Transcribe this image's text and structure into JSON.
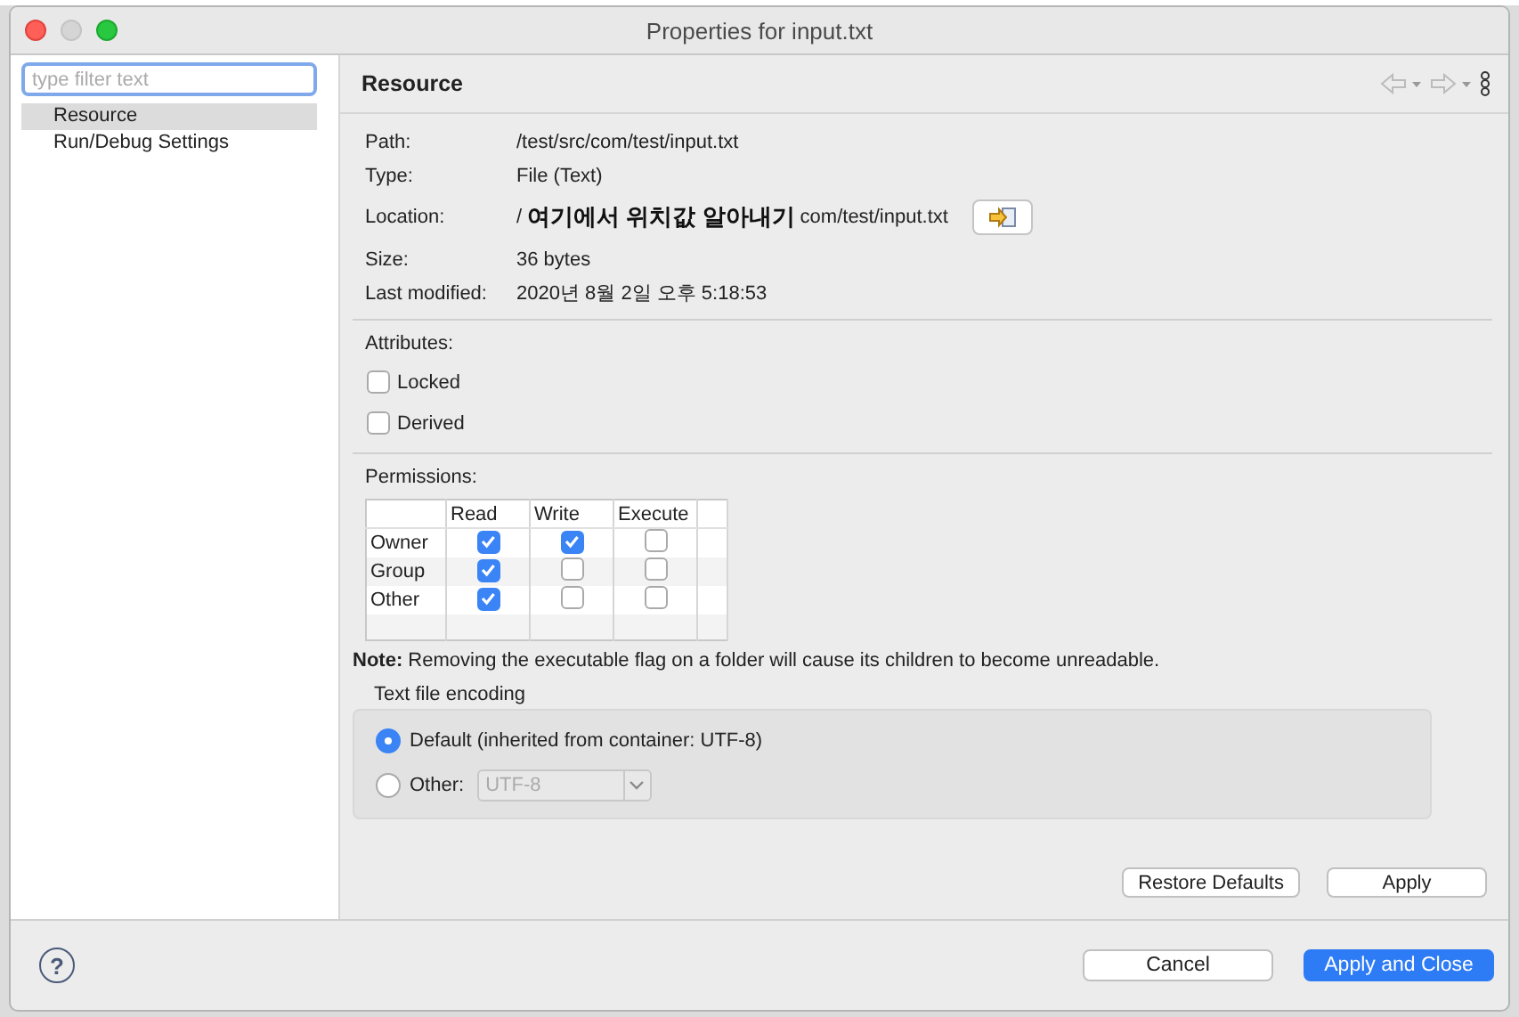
{
  "window": {
    "title": "Properties for input.txt"
  },
  "filter": {
    "placeholder": "type filter text"
  },
  "sidebar": {
    "items": [
      {
        "label": "Resource",
        "selected": true
      },
      {
        "label": "Run/Debug Settings",
        "selected": false
      }
    ]
  },
  "page": {
    "title": "Resource",
    "info": [
      {
        "label": "Path:",
        "value": "/test/src/com/test/input.txt"
      },
      {
        "label": "Type:",
        "value": "File  (Text)"
      },
      {
        "label": "Location:",
        "kind": "location",
        "value_start": "/",
        "annotation": "여기에서 위치값 알아내기",
        "value_end": "com/test/input.txt"
      },
      {
        "label": "Size:",
        "value": "36  bytes"
      },
      {
        "label": "Last modified:",
        "value": "2020년 8월 2일 오후 5:18:53"
      }
    ],
    "attributes_label": "Attributes:",
    "attributes": [
      {
        "label": "Locked",
        "checked": false
      },
      {
        "label": "Derived",
        "checked": false
      }
    ],
    "permissions_label": "Permissions:",
    "permissions": {
      "columns": [
        "Read",
        "Write",
        "Execute"
      ],
      "rows": [
        {
          "label": "Owner",
          "cells": [
            {
              "checked": true
            },
            {
              "checked": true
            },
            {
              "checked": false
            }
          ]
        },
        {
          "label": "Group",
          "cells": [
            {
              "checked": true
            },
            {
              "checked": false
            },
            {
              "checked": false
            }
          ]
        },
        {
          "label": "Other",
          "cells": [
            {
              "checked": true
            },
            {
              "checked": false
            },
            {
              "checked": false
            }
          ]
        }
      ]
    },
    "note_label": "Note:",
    "note": "Removing the executable flag on a folder will cause its children to become unreadable.",
    "encoding": {
      "title": "Text file encoding",
      "options": [
        {
          "label": "Default (inherited from container: UTF-8)",
          "selected": true
        },
        {
          "label": "Other:",
          "selected": false,
          "combo": "UTF-8",
          "combo_disabled": true
        }
      ]
    },
    "buttons": [
      "Restore Defaults",
      "Apply"
    ]
  },
  "footer": {
    "help": "?",
    "buttons": [
      {
        "label": "Cancel",
        "default": false
      },
      {
        "label": "Apply and Close",
        "default": true
      }
    ]
  }
}
